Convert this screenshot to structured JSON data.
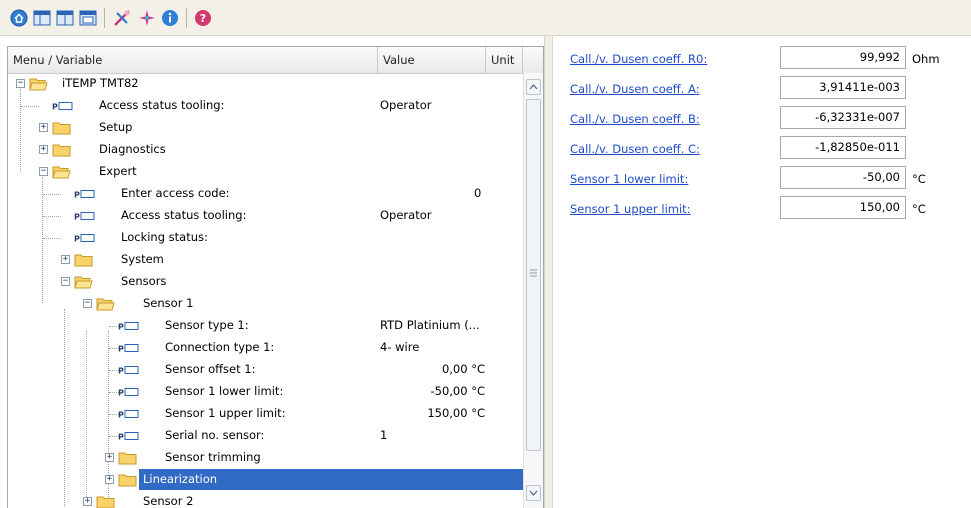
{
  "toolbar": {
    "icons": [
      "home-icon",
      "table-view-icon",
      "table-view-alt-icon",
      "list-view-icon",
      "connect-tools-icon",
      "sparkle-icon",
      "info-icon",
      "help-icon"
    ]
  },
  "tree": {
    "columns": {
      "menu": "Menu / Variable",
      "value": "Value",
      "unit": "Unit"
    },
    "rows": [
      {
        "label": "iTEMP TMT82"
      },
      {
        "label": "Access status tooling:",
        "value": "Operator"
      },
      {
        "label": "Setup"
      },
      {
        "label": "Diagnostics"
      },
      {
        "label": "Expert"
      },
      {
        "label": "Enter access code:",
        "value": "0"
      },
      {
        "label": "Access status tooling:",
        "value": "Operator"
      },
      {
        "label": "Locking status:"
      },
      {
        "label": "System"
      },
      {
        "label": "Sensors"
      },
      {
        "label": "Sensor 1"
      },
      {
        "label": "Sensor type 1:",
        "value": "RTD Platinium (..."
      },
      {
        "label": "Connection type 1:",
        "value": "4- wire"
      },
      {
        "label": "Sensor offset 1:",
        "value": "0,00 °C"
      },
      {
        "label": "Sensor 1 lower limit:",
        "value": "-50,00 °C"
      },
      {
        "label": "Sensor 1 upper limit:",
        "value": "150,00 °C"
      },
      {
        "label": "Serial no. sensor:",
        "value": "1"
      },
      {
        "label": "Sensor trimming"
      },
      {
        "label": "Linearization"
      },
      {
        "label": "Sensor 2"
      }
    ]
  },
  "params": [
    {
      "label": "Call./v. Dusen coeff. R0:",
      "value": "99,992",
      "unit": "Ohm"
    },
    {
      "label": "Call./v. Dusen coeff. A:",
      "value": "3,91411e-003",
      "unit": ""
    },
    {
      "label": "Call./v. Dusen coeff. B:",
      "value": "-6,32331e-007",
      "unit": ""
    },
    {
      "label": "Call./v. Dusen coeff. C:",
      "value": "-1,82850e-011",
      "unit": ""
    },
    {
      "label": "Sensor 1 lower limit:",
      "value": "-50,00",
      "unit": "°C"
    },
    {
      "label": "Sensor 1 upper limit:",
      "value": "150,00",
      "unit": "°C"
    }
  ]
}
